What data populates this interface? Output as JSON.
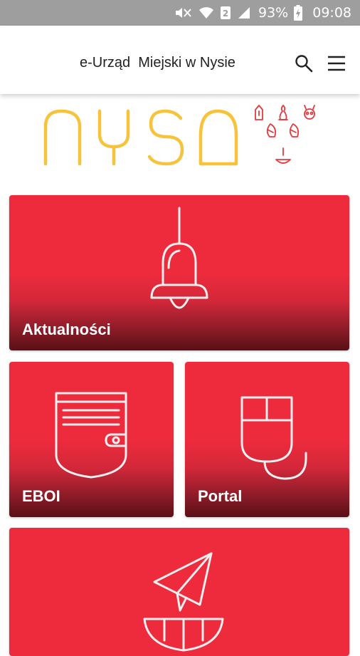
{
  "status_bar": {
    "battery_percent": "93%",
    "time": "09:08",
    "icons": [
      "mute-icon",
      "wifi-icon",
      "sim-2-icon",
      "signal-icon",
      "battery-charging-icon"
    ]
  },
  "app_bar": {
    "title": "e-Urząd  Miejski w Nysie",
    "actions": [
      "search-icon",
      "menu-icon"
    ]
  },
  "logo": {
    "text": "NYSA",
    "primary_color": "#f7c33a",
    "accent_color": "#e63a3e"
  },
  "tiles": [
    {
      "label": "Aktualności",
      "icon": "bell-icon"
    },
    {
      "label": "EBOI",
      "icon": "wallet-icon"
    },
    {
      "label": "Portal",
      "icon": "computer-mouse-icon"
    },
    {
      "label": "",
      "icon": "paper-plane-icon"
    }
  ],
  "colors": {
    "status_bar": "#9e9e9e",
    "tile_red": "#ee2b3d",
    "tile_dark": "#5a1016"
  }
}
